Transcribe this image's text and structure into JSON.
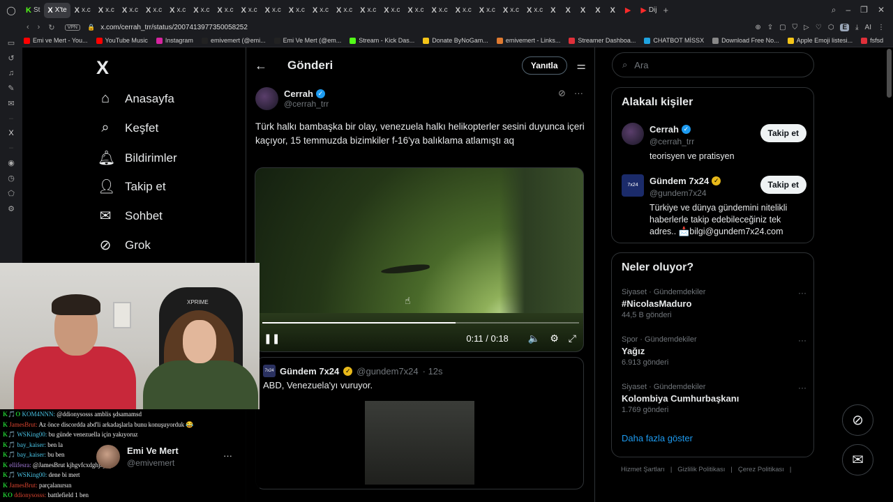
{
  "browser": {
    "tabs": [
      {
        "icon": "K",
        "label": "St",
        "color": "#53fc18"
      },
      {
        "icon": "X",
        "label": "X'te",
        "active": true
      },
      {
        "icon": "X",
        "label": "x.c"
      },
      {
        "icon": "X",
        "label": "x.c"
      },
      {
        "icon": "X",
        "label": "x.c"
      },
      {
        "icon": "X",
        "label": "x.c"
      },
      {
        "icon": "X",
        "label": "x.c"
      },
      {
        "icon": "X",
        "label": "x.c"
      },
      {
        "icon": "X",
        "label": "x.c"
      },
      {
        "icon": "X",
        "label": "x.c"
      },
      {
        "icon": "X",
        "label": "x.c"
      },
      {
        "icon": "X",
        "label": "x.c"
      },
      {
        "icon": "X",
        "label": "x.c"
      },
      {
        "icon": "X",
        "label": "x.c"
      },
      {
        "icon": "X",
        "label": "x.c"
      },
      {
        "icon": "X",
        "label": "x.c"
      },
      {
        "icon": "X",
        "label": "x.c"
      },
      {
        "icon": "X",
        "label": "x.c"
      },
      {
        "icon": "X",
        "label": "x.c"
      },
      {
        "icon": "X",
        "label": "x.c"
      },
      {
        "icon": "X",
        "label": "x.c"
      },
      {
        "icon": "X",
        "label": "x.c"
      },
      {
        "icon": "X",
        "label": ""
      },
      {
        "icon": "X",
        "label": ""
      },
      {
        "icon": "X",
        "label": ""
      },
      {
        "icon": "X",
        "label": ""
      },
      {
        "icon": "X",
        "label": ""
      },
      {
        "icon": "▶",
        "label": "",
        "color": "#ff2a2a"
      },
      {
        "icon": "▶",
        "label": "Dij",
        "color": "#ff2a2a"
      }
    ],
    "vpn": "VPN",
    "url": "x.com/cerrah_trr/status/2007413977350058252",
    "extension_badge": "E",
    "ai_label": "AI",
    "bookmarks": [
      {
        "label": "Emi ve Mert - You...",
        "color": "#ff0000"
      },
      {
        "label": "YouTube Music",
        "color": "#ff0000"
      },
      {
        "label": "Instagram",
        "color": "#d6249f"
      },
      {
        "label": "emivemert (@emi...",
        "color": "#222"
      },
      {
        "label": "Emi Ve Mert (@em...",
        "color": "#222"
      },
      {
        "label": "Stream - Kick Das...",
        "color": "#53fc18"
      },
      {
        "label": "Donate ByNoGam...",
        "color": "#f5c518"
      },
      {
        "label": "emivemert - Links...",
        "color": "#e07a30"
      },
      {
        "label": "Streamer Dashboa...",
        "color": "#e0303a"
      },
      {
        "label": "CHATBOT MİSSX",
        "color": "#1fa3e0"
      },
      {
        "label": "Download Free No...",
        "color": "#888"
      },
      {
        "label": "Apple Emoji listesi...",
        "color": "#f5c518"
      },
      {
        "label": "fsfsd",
        "color": "#e0303a"
      }
    ]
  },
  "nav": {
    "logo": "X",
    "items": [
      {
        "label": "Anasayfa",
        "icon": "home-icon"
      },
      {
        "label": "Keşfet",
        "icon": "search-icon"
      },
      {
        "label": "Bildirimler",
        "icon": "bell-icon"
      },
      {
        "label": "Takip et",
        "icon": "follow-icon"
      },
      {
        "label": "Sohbet",
        "icon": "mail-icon"
      },
      {
        "label": "Grok",
        "icon": "grok-icon"
      }
    ]
  },
  "post": {
    "header_title": "Gönderi",
    "reply_label": "Yanıtla",
    "author_name": "Cerrah",
    "author_handle": "@cerrah_trr",
    "text": "Türk halkı bambaşka bir olay, venezuela halkı helikopterler sesini duyunca içeri kaçıyor, 15 temmuzda bizimkiler f-16'ya balıklama atlamıştı aq",
    "video": {
      "time": "0:11 / 0:18",
      "progress": 0.611
    },
    "quote": {
      "avatar_text": "7x24",
      "name": "Gündem 7x24",
      "handle": "@gundem7x24",
      "time": "· 12s",
      "text": "ABD, Venezuela'yı vuruyor."
    }
  },
  "right": {
    "search_placeholder": "Ara",
    "related_title": "Alakalı kişiler",
    "people": [
      {
        "name": "Cerrah",
        "handle": "@cerrah_trr",
        "bio": "teorisyen ve pratisyen",
        "follow": "Takip et",
        "badge": "blue"
      },
      {
        "name": "Gündem 7x24",
        "handle": "@gundem7x24",
        "bio": "Türkiye ve dünya gündemini nitelikli haberlerle takip edebileceğiniz tek adres.. 📩bilgi@gundem7x24.com",
        "follow": "Takip et",
        "badge": "gold",
        "avatar_text": "7x24"
      }
    ],
    "trends_title": "Neler oluyor?",
    "trends": [
      {
        "meta": "Siyaset · Gündemdekiler",
        "title": "#NicolasMaduro",
        "count": "44,5 B gönderi"
      },
      {
        "meta": "Spor · Gündemdekiler",
        "title": "Yağız",
        "count": "6.913 gönderi"
      },
      {
        "meta": "Siyaset · Gündemdekiler",
        "title": "Kolombiya Cumhurbaşkanı",
        "count": "1.769 gönderi"
      }
    ],
    "show_more": "Daha fazla göster",
    "footer": [
      "Hizmet Şartları",
      "|",
      "Gizlilik Politikası",
      "|",
      "Çerez Politikası",
      "|"
    ]
  },
  "stream": {
    "chair_brand": "XPRIME",
    "chat": [
      {
        "badge": "K🎵O",
        "user": "KOM4NNN:",
        "msg": "@ddionysosss amblis şdsamamsd",
        "color": "blue"
      },
      {
        "badge": "K",
        "user": "JamesBrut:",
        "msg": "Az önce discordda abd'li arkadaşlarla bunu konuşuyorduk 😂",
        "color": "red"
      },
      {
        "badge": "K🎵",
        "user": "WSKing00:",
        "msg": "bu günde venezuella için yakıyoruz",
        "color": "blue"
      },
      {
        "badge": "K🎵",
        "user": "bay_kaiser:",
        "msg": "ben la",
        "color": "blue"
      },
      {
        "badge": "K🎵",
        "user": "bay_kaiser:",
        "msg": "bu ben",
        "color": "blue"
      },
      {
        "badge": "K",
        "user": "ellifesra:",
        "msg": "@JamesBrut kjhgvfcxdghjkjngf",
        "color": "pink"
      },
      {
        "badge": "K🎵",
        "user": "WSKing00:",
        "msg": "dene bi mert",
        "color": "blue"
      },
      {
        "badge": "K",
        "user": "JamesBrut:",
        "msg": "parçalanırsın",
        "color": "red"
      },
      {
        "badge": "KO",
        "user": "ddionysosss:",
        "msg": "battlefield 1 ben",
        "color": "red"
      }
    ]
  },
  "account": {
    "name": "Emi Ve Mert",
    "handle": "@emivemert"
  }
}
